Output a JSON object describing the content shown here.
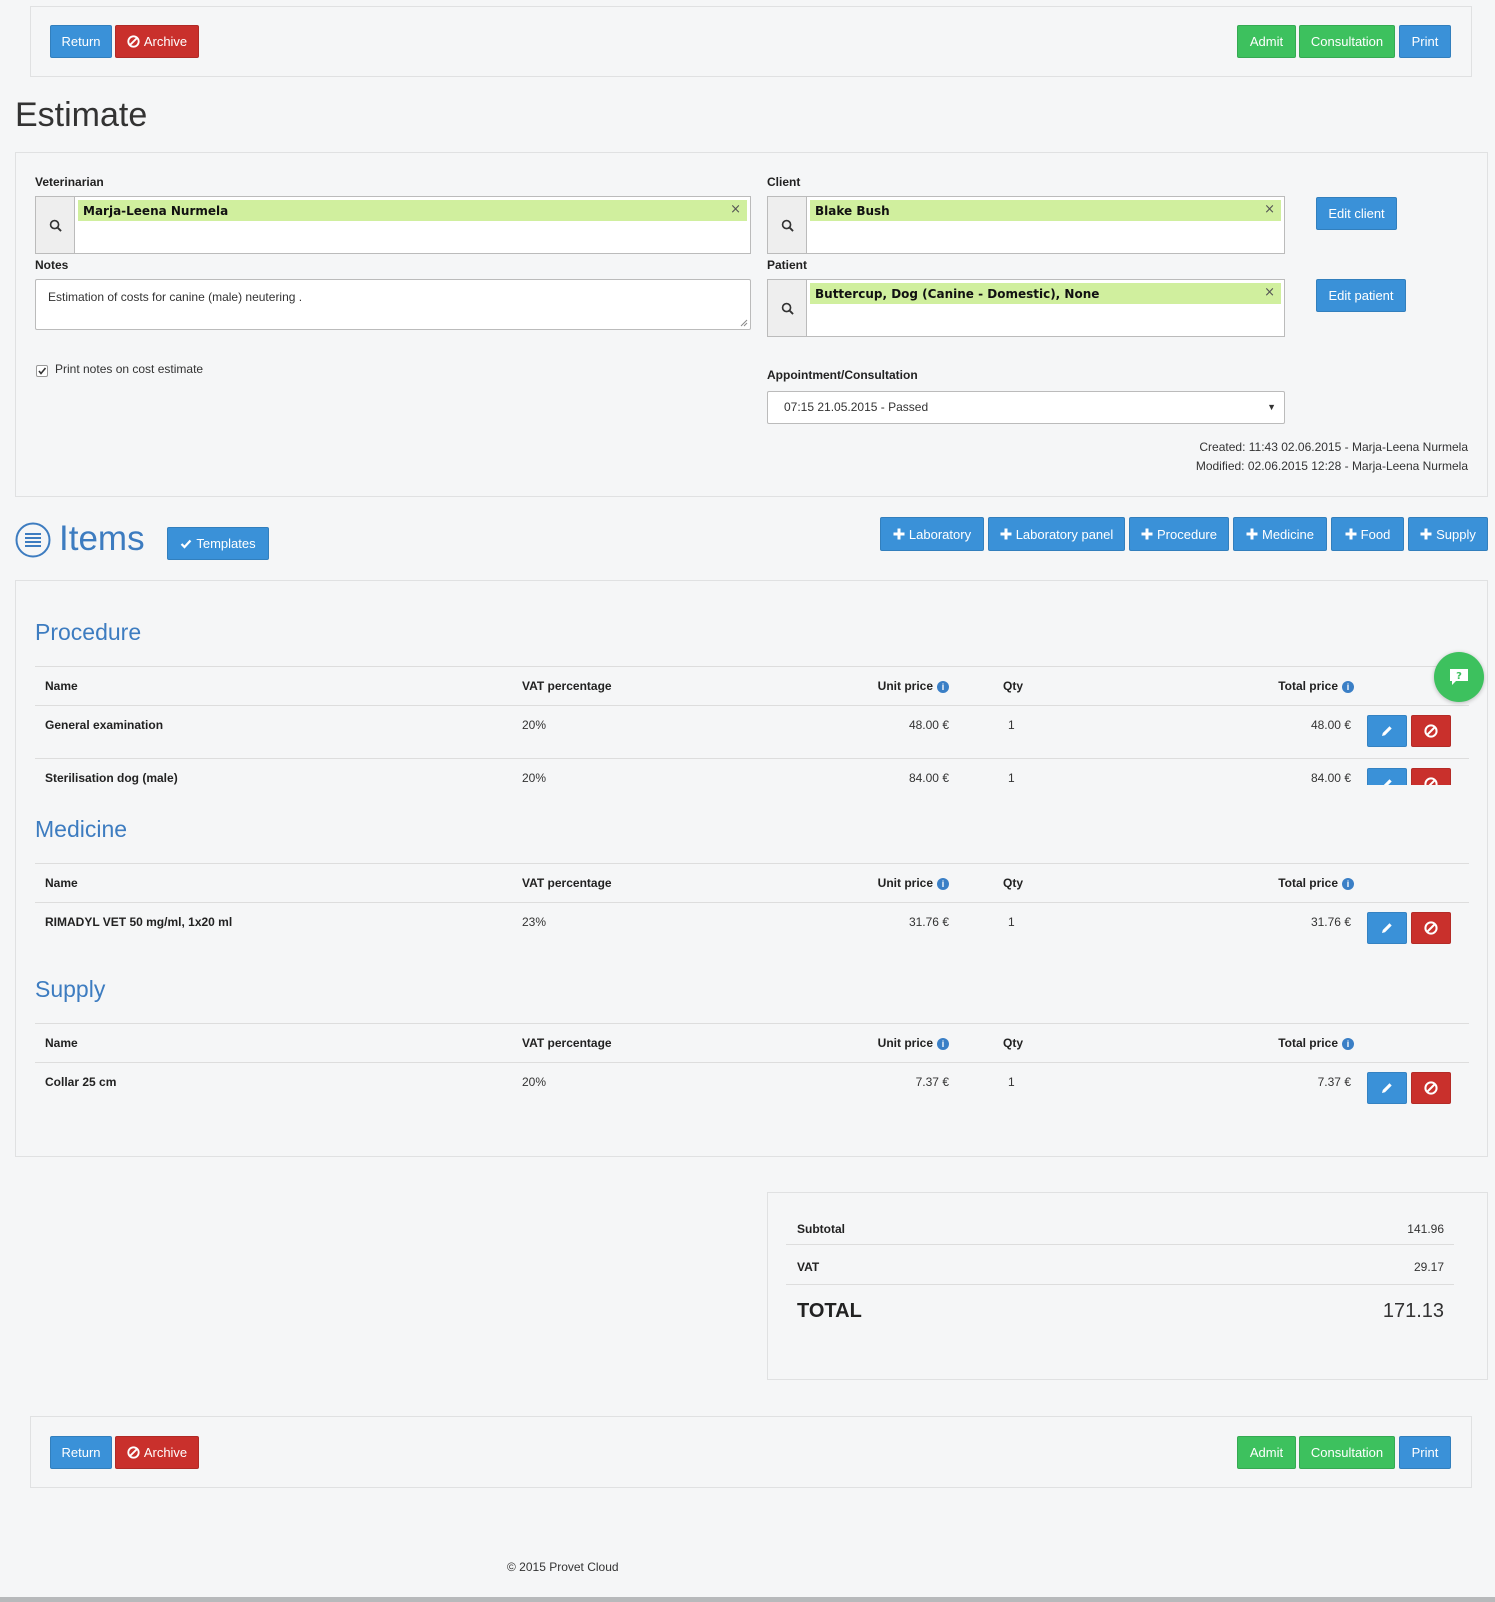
{
  "toolbar": {
    "return_label": "Return",
    "archive_label": "Archive",
    "admit_label": "Admit",
    "consultation_label": "Consultation",
    "print_label": "Print"
  },
  "page_title": "Estimate",
  "form": {
    "veterinarian_label": "Veterinarian",
    "veterinarian_value": "Marja-Leena Nurmela",
    "client_label": "Client",
    "client_value": "Blake Bush",
    "edit_client_label": "Edit client",
    "notes_label": "Notes",
    "notes_value": "Estimation of costs for canine (male) neutering .",
    "patient_label": "Patient",
    "patient_value": "Buttercup, Dog (Canine - Domestic), None",
    "edit_patient_label": "Edit patient",
    "print_notes_label": "Print notes on cost estimate",
    "print_notes_checked": true,
    "appointment_label": "Appointment/Consultation",
    "appointment_value": "07:15 21.05.2015 - Passed",
    "created_text": "Created: 11:43 02.06.2015 - Marja-Leena Nurmela",
    "modified_text": "Modified: 02.06.2015 12:28 - Marja-Leena Nurmela"
  },
  "items": {
    "title": "Items",
    "templates_label": "Templates",
    "add_buttons": [
      "Laboratory",
      "Laboratory panel",
      "Procedure",
      "Medicine",
      "Food",
      "Supply"
    ]
  },
  "table_headers": {
    "name": "Name",
    "vat": "VAT percentage",
    "unit_price": "Unit price",
    "qty": "Qty",
    "total_price": "Total price"
  },
  "sections": [
    {
      "title": "Procedure",
      "rows": [
        {
          "name": "General examination",
          "vat": "20%",
          "unit_price": "48.00 €",
          "qty": "1",
          "total": "48.00 €"
        },
        {
          "name": "Sterilisation dog (male)",
          "vat": "20%",
          "unit_price": "84.00 €",
          "qty": "1",
          "total": "84.00 €"
        }
      ]
    },
    {
      "title": "Medicine",
      "rows": [
        {
          "name": "RIMADYL VET 50 mg/ml, 1x20 ml",
          "vat": "23%",
          "unit_price": "31.76 €",
          "qty": "1",
          "total": "31.76 €"
        }
      ]
    },
    {
      "title": "Supply",
      "rows": [
        {
          "name": "Collar 25 cm",
          "vat": "20%",
          "unit_price": "7.37 €",
          "qty": "1",
          "total": "7.37 €"
        }
      ]
    }
  ],
  "totals": {
    "subtotal_label": "Subtotal",
    "subtotal_value": "141.96",
    "vat_label": "VAT",
    "vat_value": "29.17",
    "total_label": "TOTAL",
    "total_value": "171.13"
  },
  "footer": {
    "copyright": "© 2015 Provet Cloud"
  },
  "colors": {
    "blue": "#3a91d8",
    "red": "#c9302c",
    "green": "#3dc15e",
    "section_title": "#3d7cc0",
    "tag_bg": "#d0ef9e"
  }
}
